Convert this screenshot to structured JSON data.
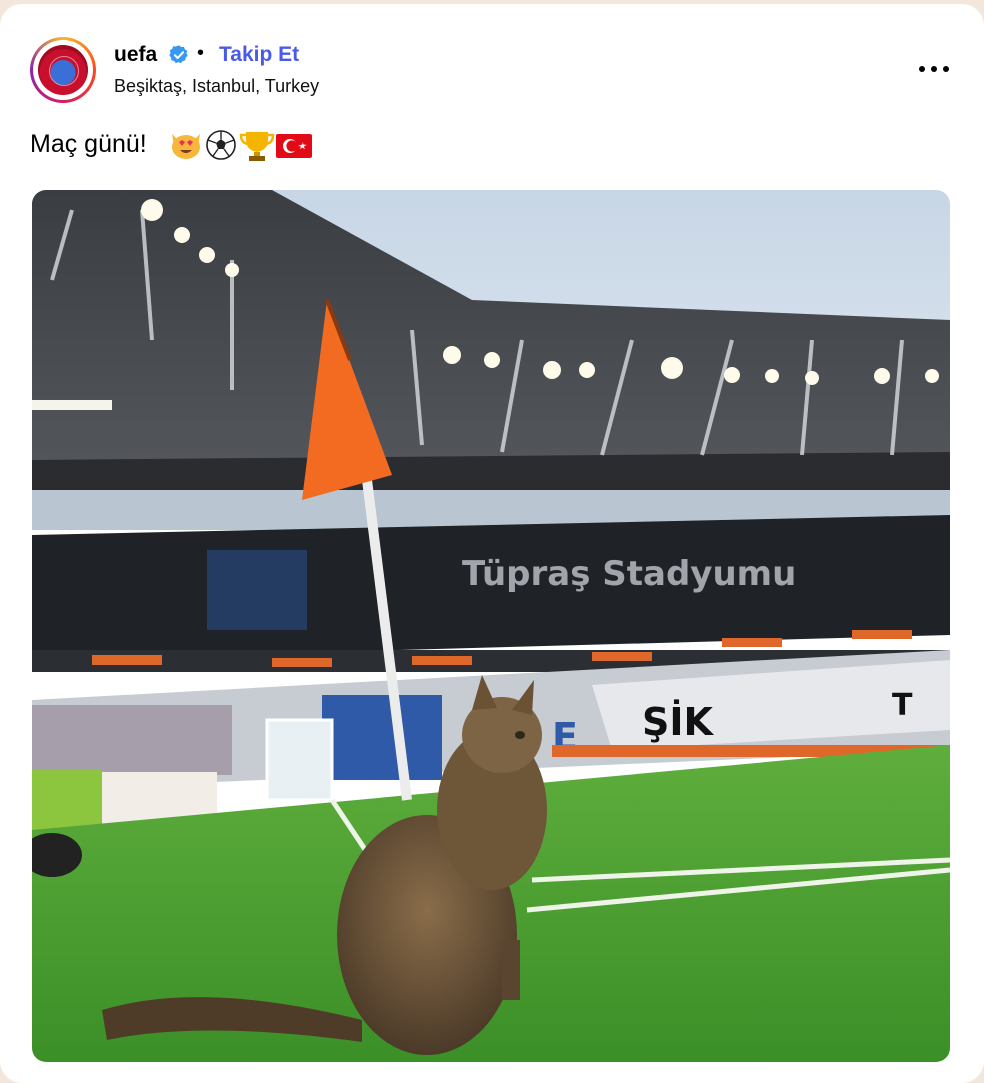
{
  "post": {
    "username": "uefa",
    "follow_label": "Takip Et",
    "separator": "•",
    "location": "Beşiktaş, Istanbul, Turkey",
    "caption": "Maç günü!",
    "caption_emojis": [
      "cat-heart-eyes-emoji",
      "soccer-ball-emoji",
      "trophy-emoji",
      "turkey-flag-emoji"
    ],
    "more_icon": "more-horizontal-icon",
    "verified_icon": "verified-badge-icon"
  },
  "photo": {
    "subject": "cat sitting by corner flag in stadium",
    "stand_letters": "ŞİK",
    "stand_letters_2": "T"
  },
  "colors": {
    "follow": "#4a5ae8",
    "verified": "#3897f0",
    "pitch": "#3f9a2e",
    "corner_flag": "#f26b21"
  }
}
